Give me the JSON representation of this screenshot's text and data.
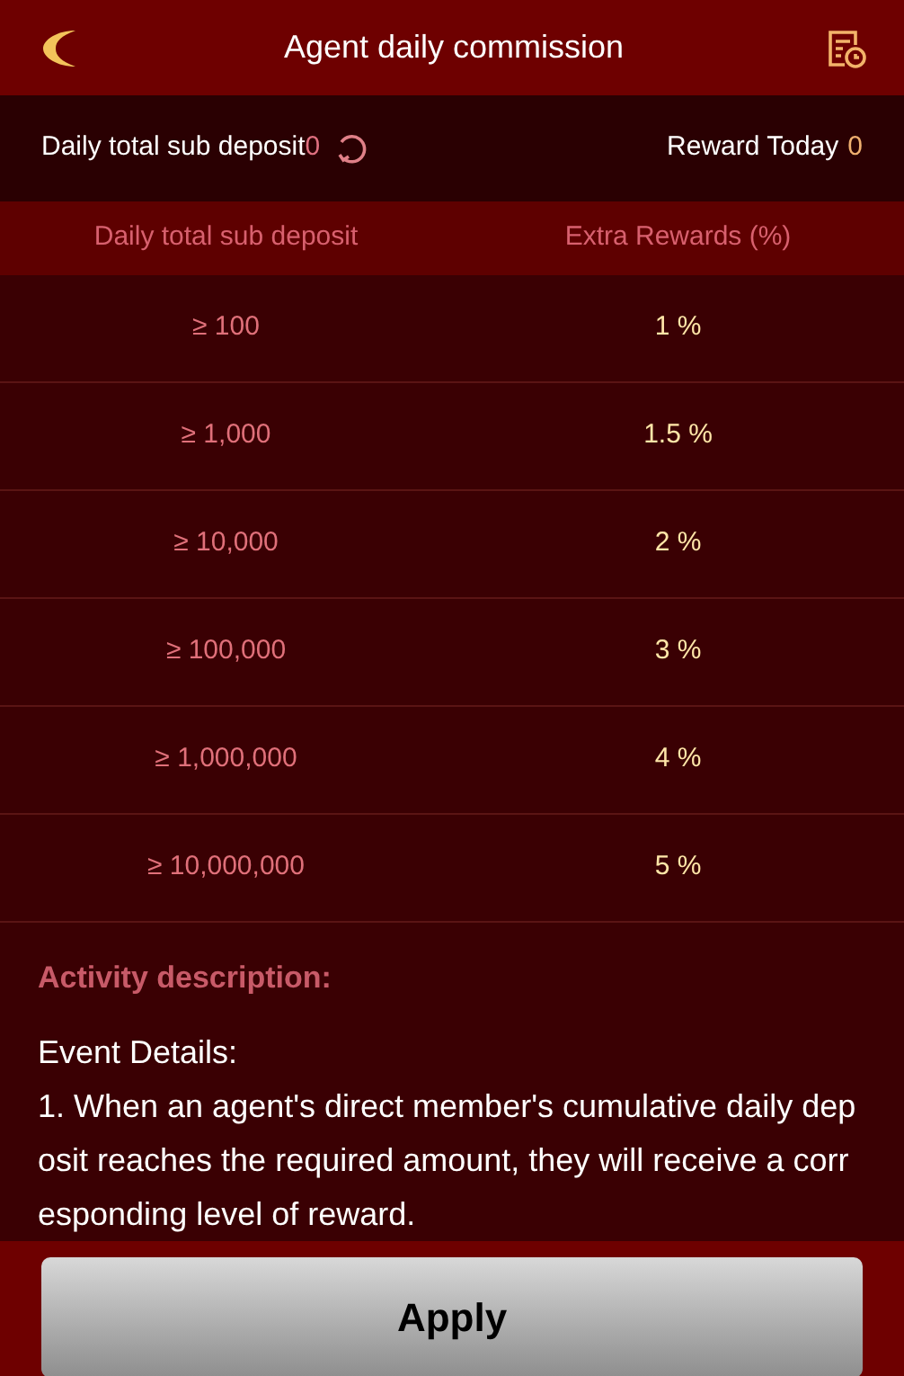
{
  "header": {
    "title": "Agent daily commission"
  },
  "summary": {
    "deposit_label": "Daily total sub deposit",
    "deposit_value": "0",
    "reward_label": "Reward Today",
    "reward_value": "0"
  },
  "table": {
    "columns": [
      "Daily total sub deposit",
      "Extra Rewards (%)"
    ],
    "rows": [
      [
        "≥ 100",
        "1 %"
      ],
      [
        "≥ 1,000",
        "1.5 %"
      ],
      [
        "≥ 10,000",
        "2 %"
      ],
      [
        "≥ 100,000",
        "3 %"
      ],
      [
        "≥ 1,000,000",
        "4 %"
      ],
      [
        "≥ 10,000,000",
        "5 %"
      ]
    ]
  },
  "description": {
    "heading": "Activity description:",
    "title": "Event Details:",
    "text": "1. When an agent's direct member's cumulative daily deposit reaches the required amount, they will receive a corresponding level of reward."
  },
  "apply_button": "Apply"
}
